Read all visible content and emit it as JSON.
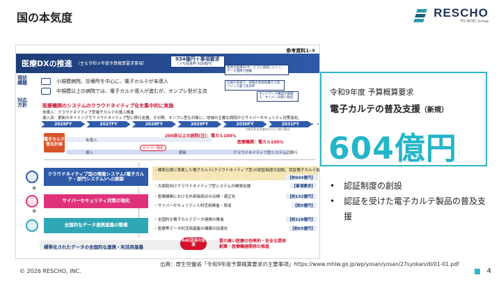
{
  "header": {
    "title": "国の本気度",
    "logo_name": "RESCHO",
    "logo_sub": "TIS INTEC Group"
  },
  "slide": {
    "ref_label": "参考資料1-③",
    "banner_title": "医療DXの推進",
    "banner_sub": "（主な令和９年度予算概算要求事項）",
    "budget_main": "934億円＋事項要求",
    "budget_sub": "（うち投資枠 928億円）",
    "callouts": [
      "政府の医療DXサービスと接続しにくく、データ連携が困難",
      "仕様が多様で、現場の改修経費や人的リソース面で非効率",
      "ネットワーク構成が複雑で、サイバー対策に負担"
    ],
    "status_tag": "現状課題",
    "status_rows": [
      "小規模病院、診療所を中心に、電子カルテが未導入",
      "中規模以上の病院では、電子カルテ導入が進むが、オンプレ型が主流"
    ],
    "policy_tag": "対応方針",
    "policy_head": "医療機関のシステムのクラウドネイティブ化を集中的に実施",
    "policy_lines": [
      "未導入：クラウドネイティブ型電子カルテの導入推進",
      "導入済：更新のタイミングでクラウドネイティブ型に移行支援。その際、オンプレ型も対象に、地域の主要な病院からサイバーセキュリティ対策強化。"
    ],
    "timeline": [
      "2026FY",
      "2027FY",
      "2028FY",
      "2029FY",
      "2030FY",
      "2031FY"
    ],
    "timeline_dots": "・・・",
    "timeline_note": "※普及率を年度末のカルテ数で算出",
    "diagram_box": "電子カルテ普及計画",
    "diagram_labels": {
      "red1": "200床以上の病院(注)：電カル100%",
      "red2": "医療機関：電カル100%",
      "not_installed": "未導入",
      "installed": "導入",
      "update": "更新",
      "cloud_migration": "クラウドネイティブ型システムに移行",
      "pill": "サイバー強化"
    },
    "measures": [
      "クラウドネイティブ型の情報システム(電子カルテ・部門システム)への刷新",
      "サイバーセキュリティ対策の強化",
      "全国的なデータ連携基盤の整備"
    ],
    "items": [
      {
        "text": "・標準仕様に準拠した電子カルテ(クラウドネイティブ型)の認証制度の創設、認証電子カルテ製品の普及支援等",
        "amount": "【約604億円】"
      },
      {
        "text": "・大病院向けクラウドネイティブ型システムの開発支援",
        "amount": "【事項要求】"
      },
      {
        "text": "・医療機関における外部接続点の点検・適正化",
        "amount": "【約132億円】"
      },
      {
        "text": "・サイバーセキュリティ人材活用推進・育成",
        "amount": "【約5億円】"
      },
      {
        "text": "・全国的な電子カルテデータ連携の推進",
        "amount": "【約128億円】"
      },
      {
        "text": "・医療等データ利活用基盤の構築の加速化",
        "amount": "【約65億円】"
      }
    ],
    "footer_left": "標準化されたデータの全国的な連携・利活用基盤",
    "ai_badge": "AI利活用の加速",
    "footer_right": [
      "質の高い医療の効率的・安全な提供",
      "創薬・医療機器開発の推進"
    ]
  },
  "panel": {
    "label": "令和9年度 予算概算要求",
    "subject": "電子カルテの普及支援",
    "subject_tag": "（新規）",
    "amount": "604億円"
  },
  "bullets": [
    "認証制度の創設",
    "認証を受けた電子カルテ製品の普及支援"
  ],
  "footer": {
    "copyright": "© 2026 RESCHO, INC.",
    "source": "出典：厚生労働省「令和9年度予算概算要求の主要事項」https://www.mhlw.go.jp/wp/yosan/yosan/27syokan/dl/01-01.pdf",
    "page_number": "4"
  },
  "colors": {
    "accent": "#2eb7c9",
    "navy": "#1e3c78",
    "red": "#d3102a",
    "pink": "#e0327a",
    "teal": "#2fa7b5"
  }
}
